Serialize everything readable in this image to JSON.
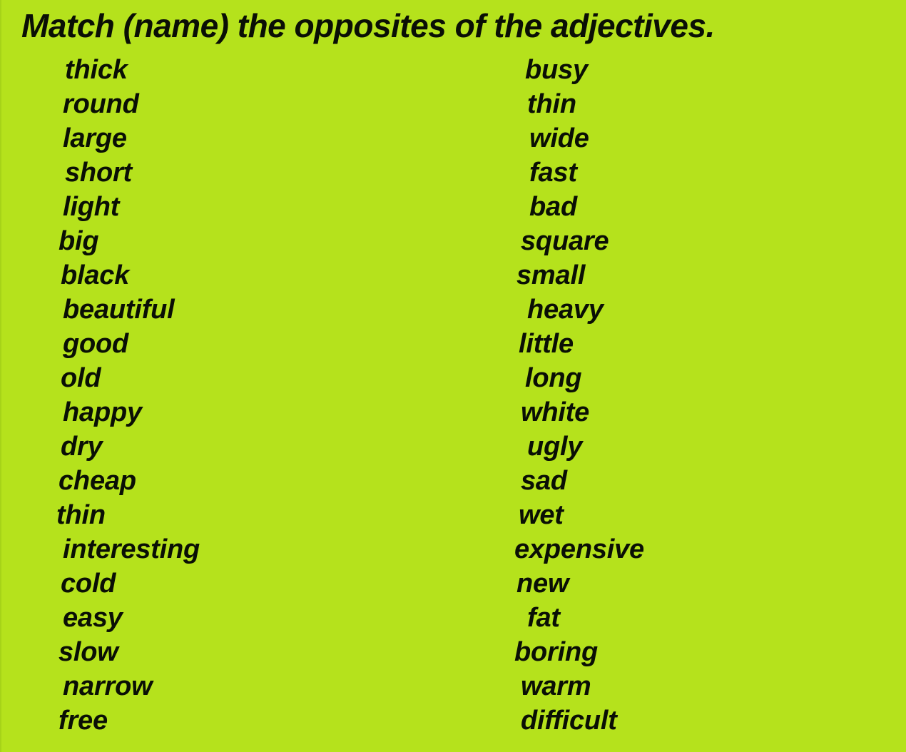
{
  "worksheet": {
    "title": "Match (name) the opposites of the adjectives.",
    "background_color": "#b5e21c",
    "text_color": "#0a0f05"
  },
  "left_column": {
    "name": "adjectives-column",
    "words": [
      "thick",
      "round",
      "large",
      "short",
      "light",
      "big",
      "black",
      "beautiful",
      "good",
      "old",
      "happy",
      "dry",
      "cheap",
      "thin",
      "interesting",
      "cold",
      "easy",
      "slow",
      "narrow",
      "free"
    ]
  },
  "right_column": {
    "name": "opposites-column",
    "words": [
      "busy",
      "thin",
      "wide",
      "fast",
      "bad",
      "square",
      "small",
      "heavy",
      "little",
      "long",
      "white",
      "ugly",
      "sad",
      "wet",
      "expensive",
      "new",
      "fat",
      "boring",
      "warm",
      "difficult"
    ]
  }
}
